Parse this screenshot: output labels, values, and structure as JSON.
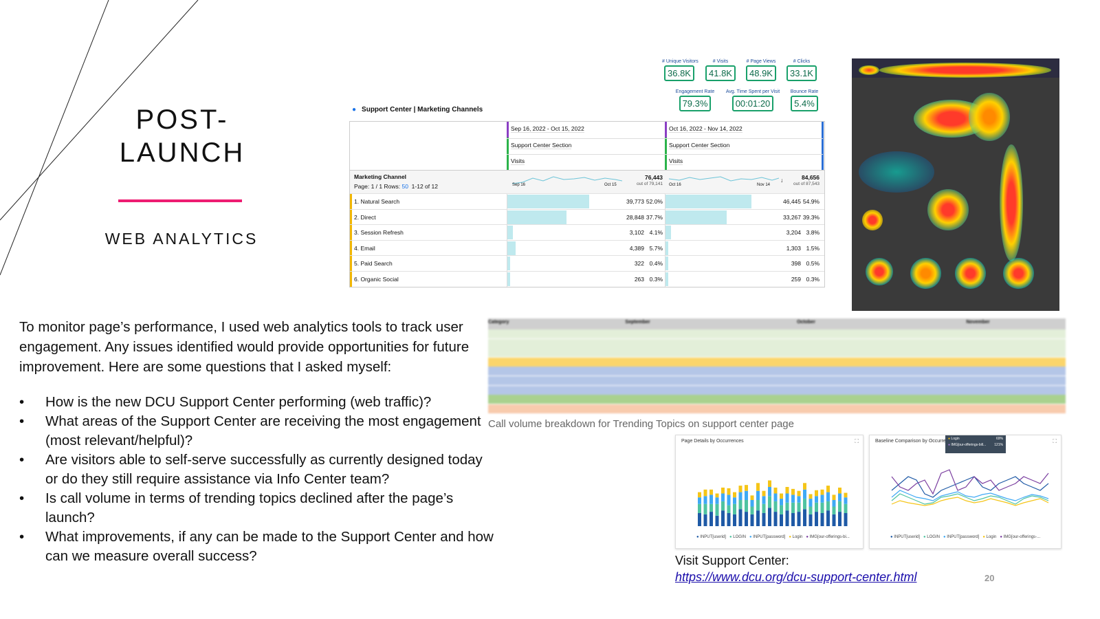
{
  "slide": {
    "title_line1": "POST-",
    "title_line2": "LAUNCH",
    "subtitle": "WEB ANALYTICS",
    "accent_color": "#ee1c72",
    "intro": "To monitor page’s performance, I used web analytics tools to track user engagement. Any issues identified would provide opportunities for future improvement. Here are some questions that I asked myself:",
    "bullet_glyph": "•",
    "questions": [
      "How is the new DCU Support Center performing (web traffic)?",
      "What areas of the Support Center are receiving the most engagement (most relevant/helpful)?",
      "Are visitors able to self-serve successfully as currently designed today or do they still require assistance via Info Center team?",
      "Is call volume in terms of trending topics declined after the page’s launch?",
      "What improvements, if any can be made to the Support Center and how can we measure overall success?"
    ],
    "call_caption": "Call volume breakdown for Trending Topics on support center page",
    "visit_label": "Visit Support Center:",
    "visit_link": "https://www.dcu.org/dcu-support-center.html",
    "page_number": "20"
  },
  "kpis": [
    {
      "label": "# Unique Visitors",
      "value": "36.8K"
    },
    {
      "label": "# Visits",
      "value": "41.8K"
    },
    {
      "label": "# Page Views",
      "value": "48.9K"
    },
    {
      "label": "# Clicks",
      "value": "33.1K"
    },
    {
      "label": "Engagement Rate",
      "value": "79.3%"
    },
    {
      "label": "Avg. Time Spent per Visit",
      "value": "00:01:20"
    },
    {
      "label": "Bounce Rate",
      "value": "5.4%"
    }
  ],
  "analytics": {
    "title": "Support Center | Marketing Channels",
    "col1": {
      "date": "Sep 16, 2022 - Oct 15, 2022",
      "segment": "Support Center Section",
      "metric": "Visits",
      "spark_start": "Sep 16",
      "spark_end": "Oct 15",
      "total": "76,443",
      "total_sub": "out of 79,141"
    },
    "col2": {
      "date": "Oct 16, 2022 - Nov 14, 2022",
      "segment": "Support Center Section",
      "metric": "Visits",
      "spark_start": "Oct 16",
      "spark_end": "Nov 14",
      "total": "84,656",
      "total_sub": "out of 87,543",
      "arrow": "↓"
    },
    "dimension": "Marketing Channel",
    "page_info": "Page: 1 / 1  Rows:",
    "rows_count": "50",
    "rows_range": "1-12 of 12",
    "rows": [
      {
        "name": "1.  Natural Search",
        "v1": "39,773",
        "p1": "52.0%",
        "f1": 0.52,
        "v2": "46,445",
        "p2": "54.9%",
        "f2": 0.549
      },
      {
        "name": "2.  Direct",
        "v1": "28,848",
        "p1": "37.7%",
        "f1": 0.377,
        "v2": "33,267",
        "p2": "39.3%",
        "f2": 0.393
      },
      {
        "name": "3.  Session Refresh",
        "v1": "3,102",
        "p1": "4.1%",
        "f1": 0.041,
        "v2": "3,204",
        "p2": "3.8%",
        "f2": 0.038
      },
      {
        "name": "4.  Email",
        "v1": "4,389",
        "p1": "5.7%",
        "f1": 0.057,
        "v2": "1,303",
        "p2": "1.5%",
        "f2": 0.015
      },
      {
        "name": "5.  Paid Search",
        "v1": "322",
        "p1": "0.4%",
        "f1": 0.004,
        "v2": "398",
        "p2": "0.5%",
        "f2": 0.005
      },
      {
        "name": "6.  Organic Social",
        "v1": "263",
        "p1": "0.3%",
        "f1": 0.003,
        "v2": "259",
        "p2": "0.3%",
        "f2": 0.003
      }
    ]
  },
  "call_table": {
    "headers": [
      "Category",
      "September",
      "October",
      "November"
    ],
    "row_colors": [
      "#e3efd9",
      "#e3efd9",
      "#e3efd9",
      "#fbd56b",
      "#b4c6e7",
      "#b4c6e7",
      "#b4c6e7",
      "#a9d18e",
      "#f8cbad"
    ]
  },
  "charts": {
    "left_title": "Page Details by Occurrences",
    "right_title": "Baseline Comparison by Occurrences",
    "legend": [
      "INPUT[userid]",
      "LOGIN",
      "INPUT[password]",
      "Login",
      "IMG[our-offerings-bi..."
    ],
    "legend_right": [
      "INPUT[userid]",
      "LOGIN",
      "INPUT[password]",
      "Login",
      "IMG[our-offerings-..."
    ],
    "series_colors": [
      "#1f5aa6",
      "#4fc3a1",
      "#3fa9f5",
      "#f5c518",
      "#7b3fa0"
    ],
    "tooltip": {
      "row1": "Login",
      "row1_val": "69%",
      "row2": "IMG[our-offerings-bill...",
      "row2_val": "121%"
    }
  }
}
